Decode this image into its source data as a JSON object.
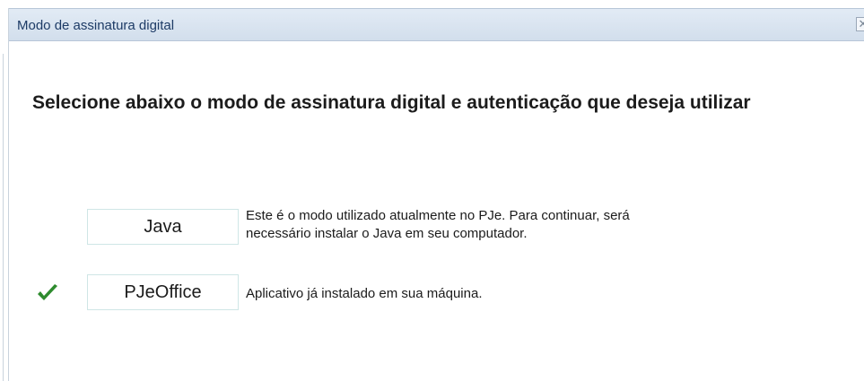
{
  "dialog": {
    "title": "Modo de assinatura digital",
    "close_symbol": "✕",
    "heading": "Selecione abaixo o modo de assinatura digital e autenticação que deseja utilizar"
  },
  "modes": [
    {
      "label": "Java",
      "description_line1": "Este é o modo utilizado atualmente no PJe. Para continuar, será",
      "description_line2": "necessário instalar o Java em seu computador.",
      "selected": false
    },
    {
      "label": "PJeOffice",
      "description_line1": "Aplicativo já instalado em sua máquina.",
      "selected": true
    }
  ],
  "colors": {
    "titlebar": "#d8e3f0",
    "title_text": "#1d3b66",
    "check": "#2e8b2e",
    "button_border": "#cfe6e6"
  },
  "icons": {
    "close": "close-icon",
    "selected": "checkmark-icon"
  }
}
